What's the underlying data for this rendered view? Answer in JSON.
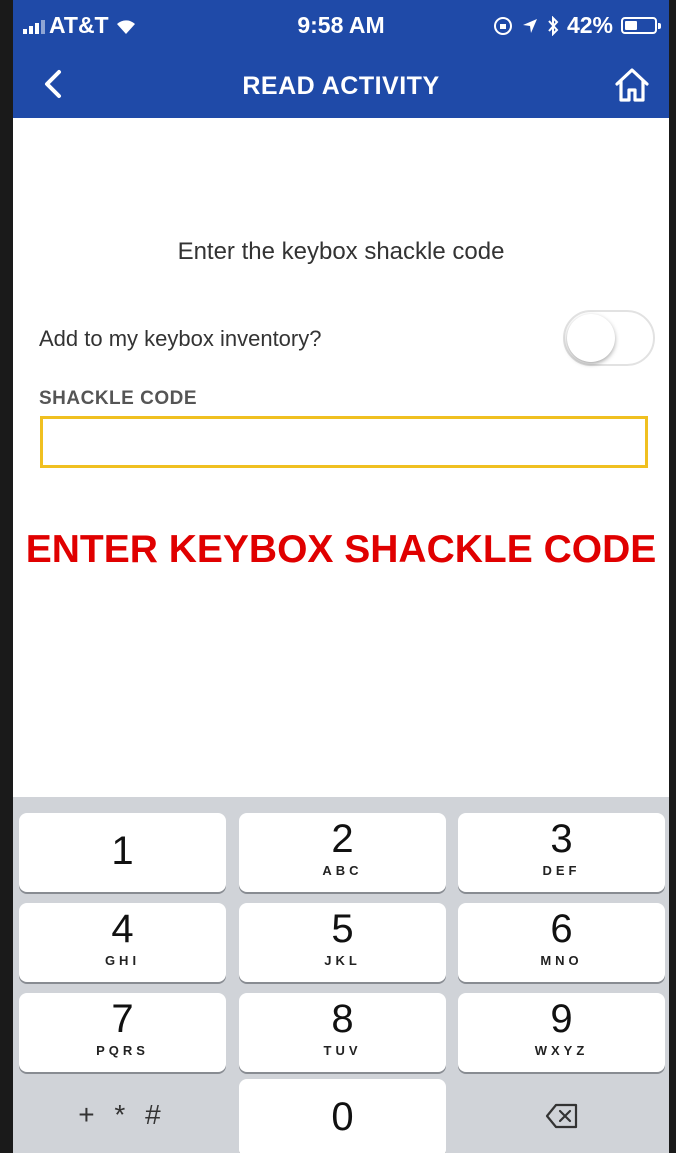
{
  "status_bar": {
    "carrier": "AT&T",
    "time": "9:58 AM",
    "battery": "42%",
    "battery_level": 0.42
  },
  "nav": {
    "title": "READ ACTIVITY",
    "back_icon": "chevron-left-icon",
    "home_icon": "home-icon"
  },
  "form": {
    "prompt": "Enter the keybox shackle code",
    "toggle_label": "Add to my keybox inventory?",
    "toggle_on": false,
    "field_label": "SHACKLE CODE",
    "field_value": ""
  },
  "caption": "ENTER KEYBOX SHACKLE CODE",
  "keypad": {
    "keys": [
      {
        "num": "1",
        "letters": ""
      },
      {
        "num": "2",
        "letters": "ABC"
      },
      {
        "num": "3",
        "letters": "DEF"
      },
      {
        "num": "4",
        "letters": "GHI"
      },
      {
        "num": "5",
        "letters": "JKL"
      },
      {
        "num": "6",
        "letters": "MNO"
      },
      {
        "num": "7",
        "letters": "PQRS"
      },
      {
        "num": "8",
        "letters": "TUV"
      },
      {
        "num": "9",
        "letters": "WXYZ"
      }
    ],
    "symbols": "+ * #",
    "zero": "0",
    "delete_icon": "backspace-icon"
  },
  "colors": {
    "header": "#1f4aa8",
    "input_border": "#f0c020",
    "caption": "#e00000",
    "keypad_bg": "#d0d3d8"
  }
}
